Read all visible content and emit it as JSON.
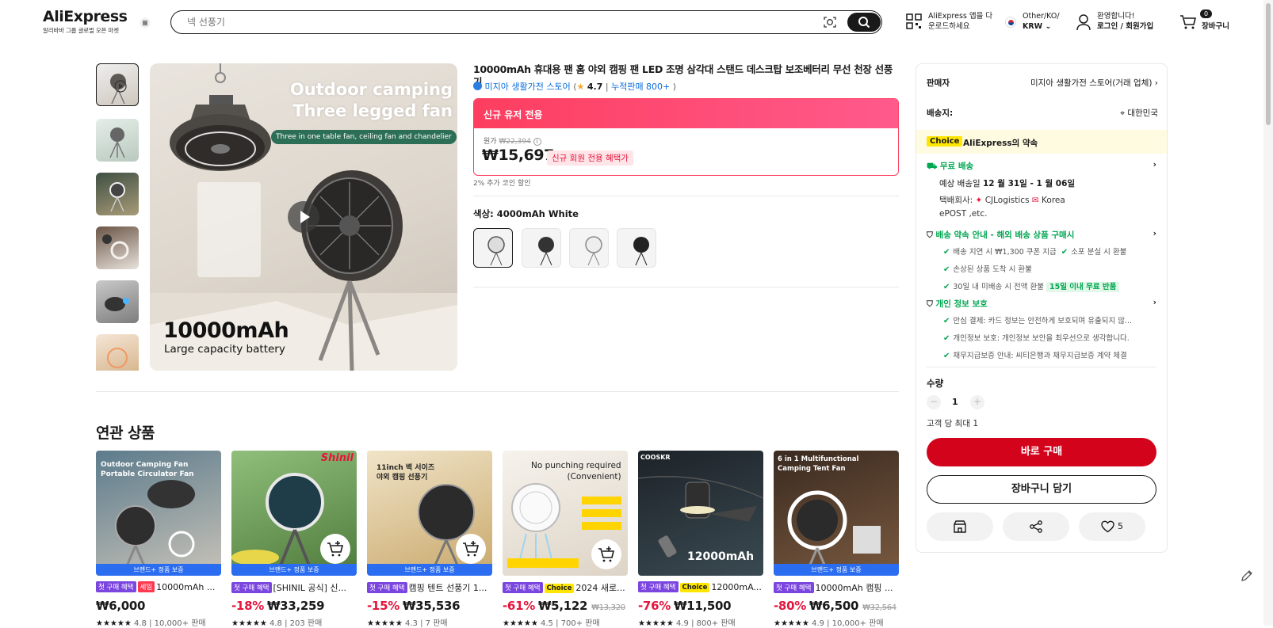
{
  "header": {
    "logo": "AliExpress",
    "logo_sub": "알리바바 그룹 글로벌 오픈 마켓",
    "search_placeholder": "넥 선풍기",
    "app_line1": "AliExpress 앱을 다",
    "app_line2": "운로드하세요",
    "region_line1": "Other/KO/",
    "region_line2": "KRW",
    "account_line1": "환영합니다!",
    "account_line2": "로그인 / 회원가입",
    "cart_count": "0",
    "cart_label": "장바구니"
  },
  "product": {
    "title": "10000mAh 휴대용 팬 홈 야외 캠핑 팬 LED 조명 삼각대 스탠드 데스크탑 보조베터리 무선 천장 선풍기",
    "store_name": "미지아 생활가전 스토어",
    "rating": "4.7",
    "sold": "누적판매 800+",
    "main_image_text1": "Outdoor camping",
    "main_image_text2": "Three legged fan",
    "main_image_banner": "Three in one table fan, ceiling fan and chandelier",
    "main_image_big": "10000mAh",
    "main_image_small": "Large capacity battery",
    "promo_header": "신규 유저 전용",
    "orig_label": "원가",
    "orig_price": "₩22,394",
    "price": "₩15,697",
    "new_badge": "신규 회원 전용 혜택가",
    "coin_text": "2% 추가 코인 할인",
    "color_label": "색상: 4000mAh White"
  },
  "panel": {
    "seller_label": "판매자",
    "seller_name": "미지아 생활가전 스토어(거래 업체)",
    "ship_to_label": "배송지:",
    "ship_to": "대한민국",
    "choice_tag": "Choice",
    "choice_text": "AliExpress의 약속",
    "free_ship": "무료 배송",
    "est_label": "예상 배송일",
    "est_date": "12 월 31일 - 1 월 06일",
    "carrier_label": "택배회사:",
    "carrier1": "CJLogistics",
    "carrier2": "Korea",
    "carrier3": "ePOST ,etc.",
    "promise_title": "배송 약속 안내 - 해외 배송 상품 구매시",
    "promise1": "배송 지연 시 ₩1,300 쿠폰 지급",
    "promise2": "소포 분실 시 환불",
    "promise3": "손상된 상품 도착 시 환불",
    "promise4": "30일 내 미배송 시 전액 환불",
    "promise4_badge": "15일 이내 무료 반품",
    "privacy_title": "개인 정보 보호",
    "privacy1": "안심 결제: 카드 정보는 안전하게 보호되며 유출되지 않...",
    "privacy2": "개인정보 보호: 개인정보 보안을 최우선으로 생각합니다.",
    "privacy3": "채무지급보증 안내: 씨티은행과 채무지급보증 계약 체결",
    "qty_label": "수량",
    "qty": "1",
    "max_note": "고객 당 최대 1",
    "buy_now": "바로 구매",
    "add_cart": "장바구니 담기",
    "wish_count": "5"
  },
  "related": {
    "title": "연관 상품",
    "brand_badge": "브랜드+ 정품 보증",
    "first_tag": "첫 구매 혜택",
    "sale_tag": "세일",
    "choice_tag": "Choice",
    "items": [
      {
        "name": "10000mAh ...",
        "price": "₩6,000",
        "discount": "",
        "orig": "",
        "rating": "4.8",
        "sold": "10,000+ 판매",
        "img_text1": "Outdoor Camping Fan",
        "img_text2": "Portable Circulator Fan"
      },
      {
        "name": "[SHINIL 공식] 신...",
        "price": "₩33,259",
        "discount": "-18%",
        "orig": "",
        "rating": "4.8",
        "sold": "203 판매",
        "img_text1": "Shinil",
        "img_text2": ""
      },
      {
        "name": "캠핑 텐트 선풍기 1...",
        "price": "₩35,536",
        "discount": "-15%",
        "orig": "",
        "rating": "4.3",
        "sold": "7 판매",
        "img_text1": "11inch 벽 서이즈",
        "img_text2": "야외 캠핑 선풍기"
      },
      {
        "name": "2024 새로...",
        "price": "₩5,122",
        "discount": "-61%",
        "orig": "₩13,320",
        "rating": "4.5",
        "sold": "700+ 판매",
        "img_text1": "No punching required",
        "img_text2": "(Convenient)"
      },
      {
        "name": "12000mA...",
        "price": "₩11,500",
        "discount": "-76%",
        "orig": "",
        "rating": "4.9",
        "sold": "800+ 판매",
        "img_text1": "12000mAh",
        "img_text2": "COOSKR"
      },
      {
        "name": "10000mAh 캠핑 ...",
        "price": "₩6,500",
        "discount": "-80%",
        "orig": "₩32,564",
        "rating": "4.9",
        "sold": "10,000+ 판매",
        "img_text1": "6 in 1 Multifunctional",
        "img_text2": "Camping Tent Fan"
      }
    ]
  }
}
